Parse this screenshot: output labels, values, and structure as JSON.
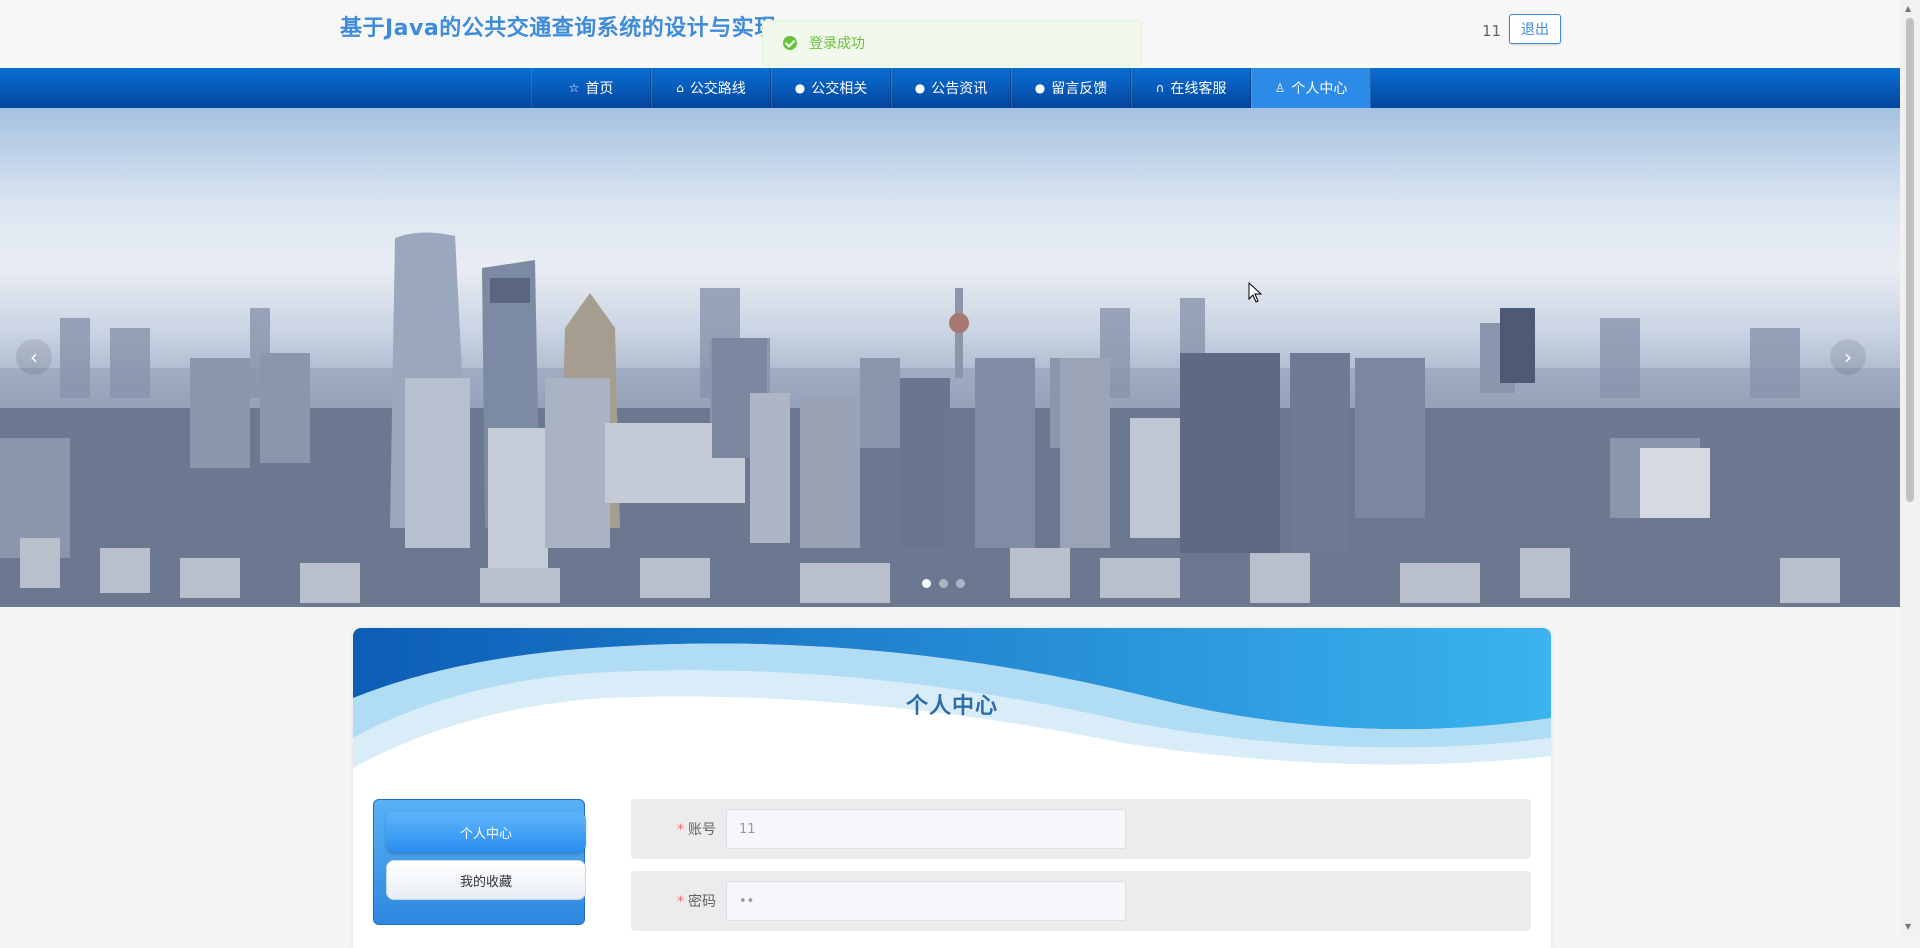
{
  "header": {
    "site_title": "基于Java的公共交通查询系统的设计与实现",
    "username": "11",
    "logout_label": "退出"
  },
  "toast": {
    "message": "登录成功"
  },
  "nav": {
    "items": [
      {
        "label": "首页",
        "icon": "star-icon"
      },
      {
        "label": "公交路线",
        "icon": "bag-icon"
      },
      {
        "label": "公交相关",
        "icon": "info-icon"
      },
      {
        "label": "公告资讯",
        "icon": "question-icon"
      },
      {
        "label": "留言反馈",
        "icon": "info-icon"
      },
      {
        "label": "在线客服",
        "icon": "headset-icon"
      },
      {
        "label": "个人中心",
        "icon": "user-icon"
      }
    ],
    "active_index": 6
  },
  "banner": {
    "slide_count": 3,
    "active_slide": 0
  },
  "panel": {
    "title": "个人中心",
    "side_menu": [
      {
        "label": "个人中心",
        "active": true
      },
      {
        "label": "我的收藏",
        "active": false
      }
    ],
    "fields": [
      {
        "label": "账号",
        "value": "11",
        "required": true
      },
      {
        "label": "密码",
        "value": "••",
        "required": true
      }
    ]
  },
  "colors": {
    "accent": "#3d8bd9",
    "nav": "#0656b4",
    "nav_active": "#2d8be8",
    "toast_success": "#67c23a"
  }
}
